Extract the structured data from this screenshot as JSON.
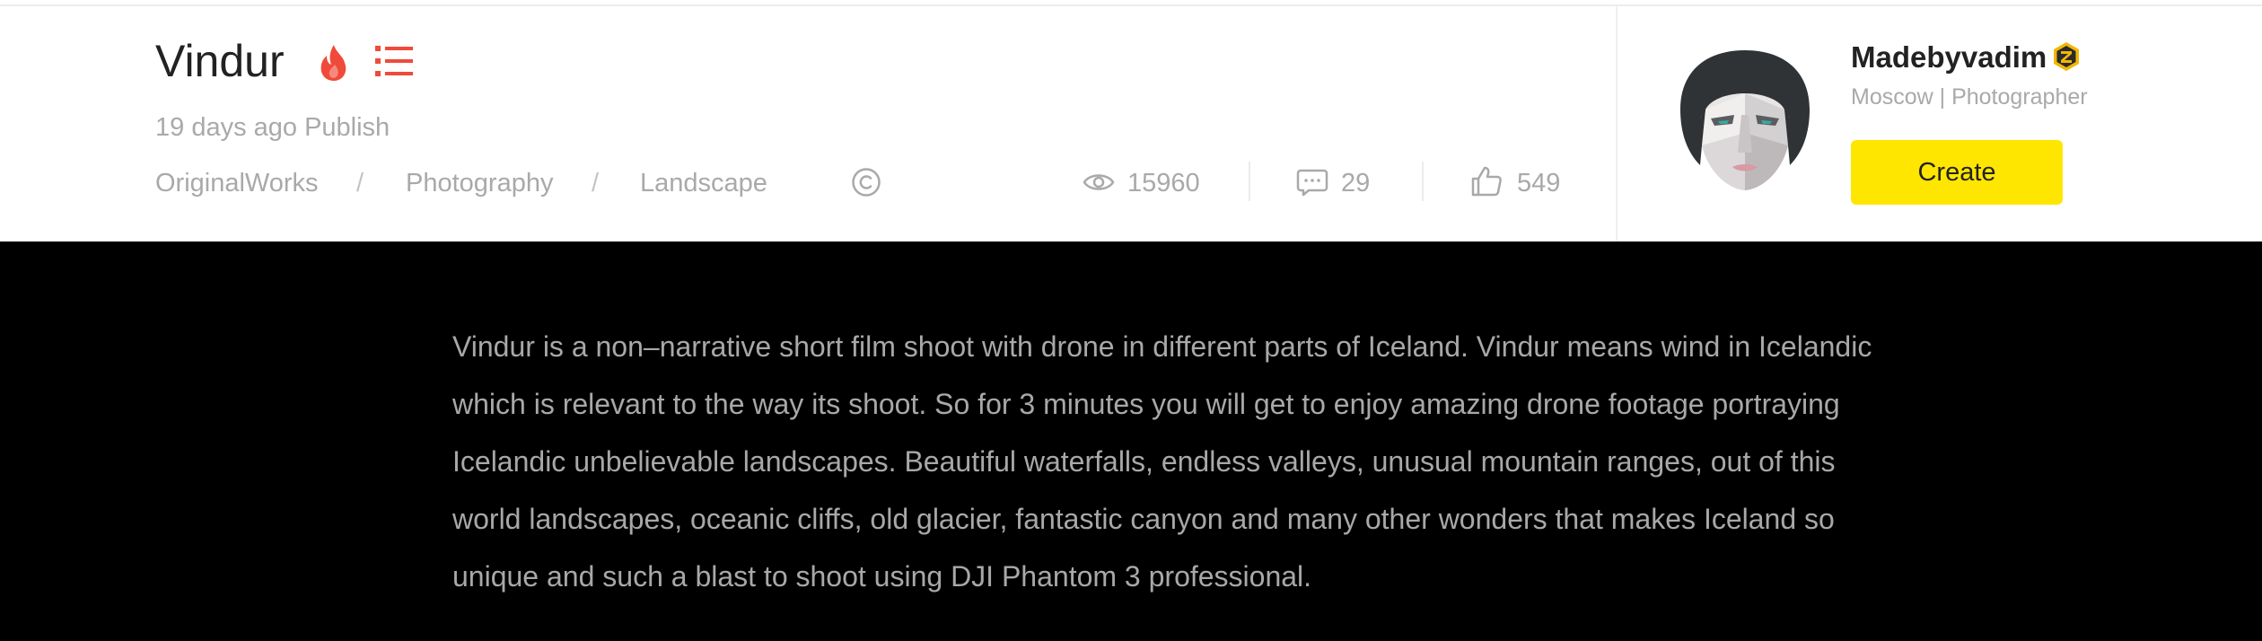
{
  "work": {
    "title": "Vindur",
    "published": "19 days ago Publish",
    "breadcrumbs": [
      "OriginalWorks",
      "Photography",
      "Landscape"
    ],
    "breadcrumb_separator": "/",
    "stats": {
      "views": "15960",
      "comments": "29",
      "likes": "549"
    },
    "description": "Vindur is a non–narrative short film shoot with drone in different parts of Iceland. Vindur means wind in Icelandic which is relevant to the way its shoot. So for 3 minutes you will get to enjoy amazing drone footage portraying Icelandic unbelievable landscapes. Beautiful waterfalls, endless valleys, unusual mountain ranges, out of this world landscapes, oceanic cliffs, old glacier, fantastic canyon and many other wonders that makes Iceland so unique and such a blast to shoot using DJI Phantom 3 professional."
  },
  "author": {
    "name": "Madebyvadim",
    "location": "Moscow",
    "role": "Photographer",
    "meta_separator": " | ",
    "create_label": "Create"
  },
  "icons": {
    "hot": "fire-icon",
    "collection": "list-icon",
    "copyright": "copyright-icon",
    "views": "eye-icon",
    "comments": "comment-icon",
    "likes": "thumbs-up-icon",
    "badge": "z-badge-icon"
  },
  "colors": {
    "accent_red": "#f04a3a",
    "button_yellow": "#ffe600",
    "badge_gold": "#f2b705",
    "text_dark": "#222222",
    "text_gray": "#a9a9a9",
    "content_bg": "#000000"
  }
}
